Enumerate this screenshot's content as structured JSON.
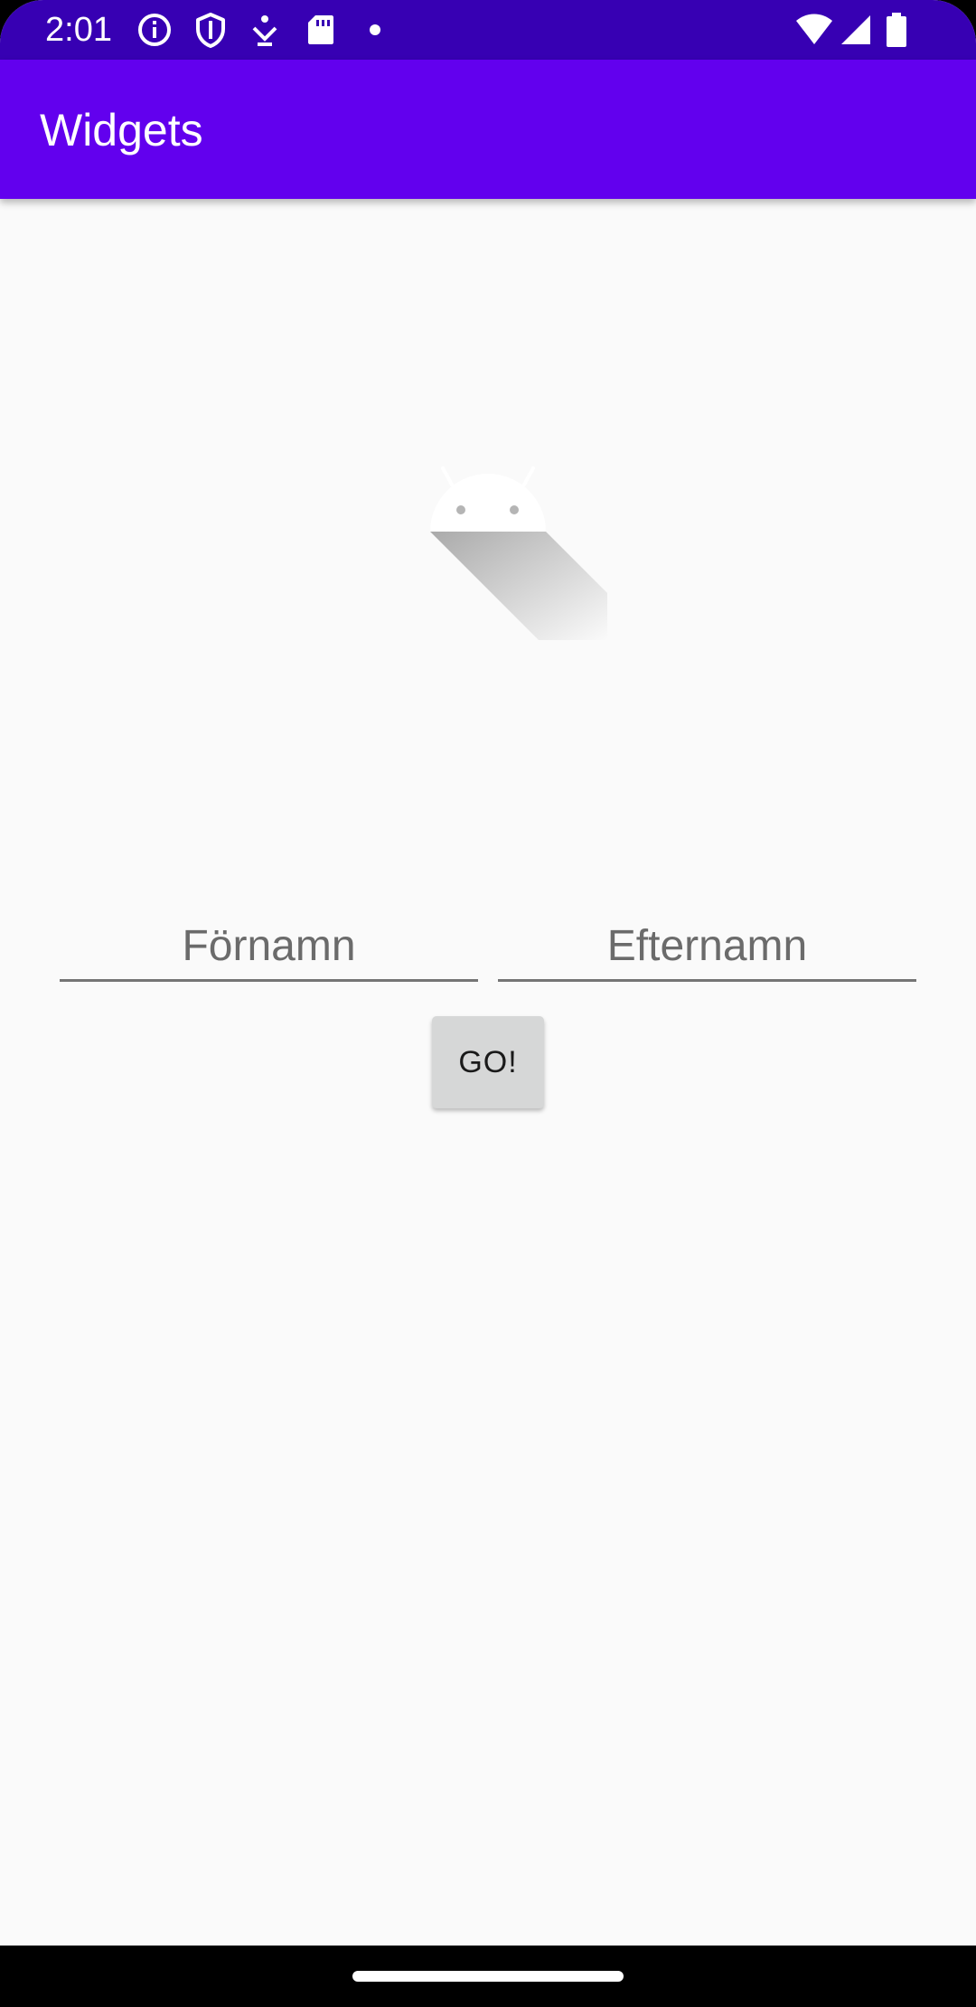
{
  "status_bar": {
    "time": "2:01",
    "background": "#3700b3",
    "icons": [
      "info-icon",
      "shield-icon",
      "download-icon",
      "sd-card-icon",
      "notification-dot-icon",
      "wifi-icon",
      "signal-icon",
      "battery-icon"
    ]
  },
  "app_bar": {
    "title": "Widgets",
    "background": "#6200ee"
  },
  "main": {
    "image": "android-logo-icon",
    "first_name": {
      "placeholder": "Förnamn",
      "value": ""
    },
    "last_name": {
      "placeholder": "Efternamn",
      "value": ""
    },
    "go_button_label": "GO!"
  },
  "nav_bar": {
    "handle": "home-gesture-handle"
  }
}
